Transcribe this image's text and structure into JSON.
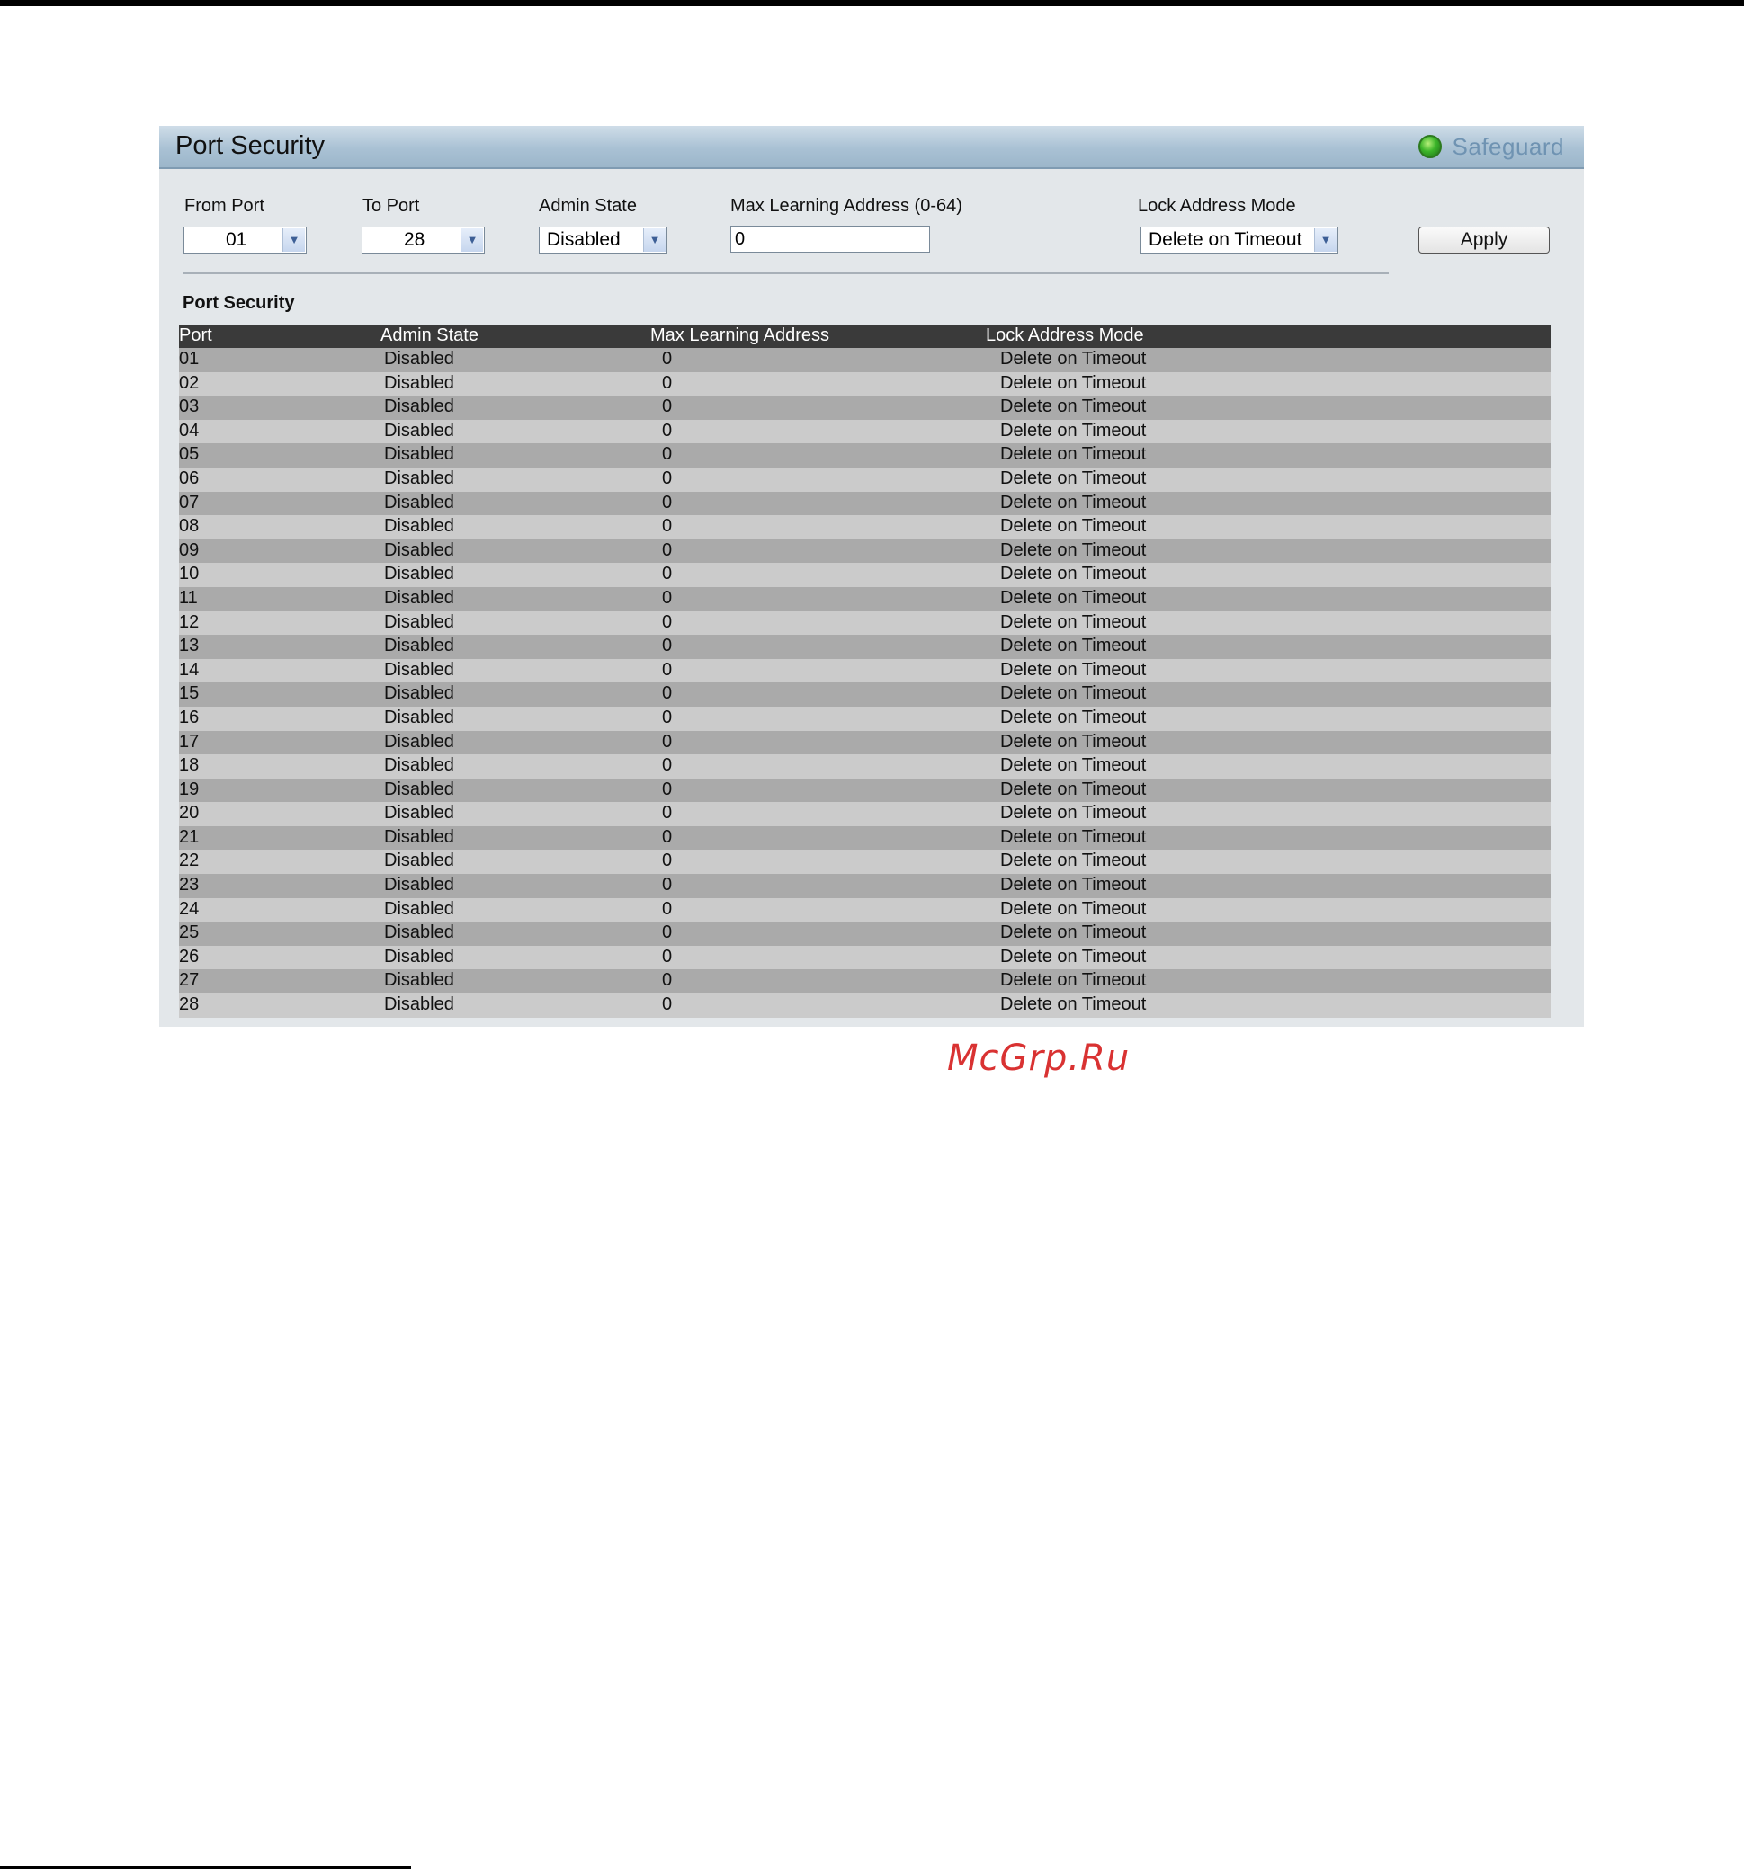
{
  "panel": {
    "title": "Port Security",
    "safeguard_label": "Safeguard"
  },
  "form": {
    "from_port_label": "From Port",
    "from_port_value": "01",
    "to_port_label": "To Port",
    "to_port_value": "28",
    "admin_state_label": "Admin State",
    "admin_state_value": "Disabled",
    "max_learning_label": "Max Learning Address (0-64)",
    "max_learning_value": "0",
    "lock_mode_label": "Lock Address Mode",
    "lock_mode_value": "Delete on Timeout",
    "apply_label": "Apply"
  },
  "table": {
    "section_title": "Port Security",
    "headers": [
      "Port",
      "Admin State",
      "Max Learning Address",
      "Lock Address Mode"
    ],
    "rows": [
      {
        "port": "01",
        "admin_state": "Disabled",
        "max_learning": "0",
        "lock_mode": "Delete on Timeout"
      },
      {
        "port": "02",
        "admin_state": "Disabled",
        "max_learning": "0",
        "lock_mode": "Delete on Timeout"
      },
      {
        "port": "03",
        "admin_state": "Disabled",
        "max_learning": "0",
        "lock_mode": "Delete on Timeout"
      },
      {
        "port": "04",
        "admin_state": "Disabled",
        "max_learning": "0",
        "lock_mode": "Delete on Timeout"
      },
      {
        "port": "05",
        "admin_state": "Disabled",
        "max_learning": "0",
        "lock_mode": "Delete on Timeout"
      },
      {
        "port": "06",
        "admin_state": "Disabled",
        "max_learning": "0",
        "lock_mode": "Delete on Timeout"
      },
      {
        "port": "07",
        "admin_state": "Disabled",
        "max_learning": "0",
        "lock_mode": "Delete on Timeout"
      },
      {
        "port": "08",
        "admin_state": "Disabled",
        "max_learning": "0",
        "lock_mode": "Delete on Timeout"
      },
      {
        "port": "09",
        "admin_state": "Disabled",
        "max_learning": "0",
        "lock_mode": "Delete on Timeout"
      },
      {
        "port": "10",
        "admin_state": "Disabled",
        "max_learning": "0",
        "lock_mode": "Delete on Timeout"
      },
      {
        "port": "11",
        "admin_state": "Disabled",
        "max_learning": "0",
        "lock_mode": "Delete on Timeout"
      },
      {
        "port": "12",
        "admin_state": "Disabled",
        "max_learning": "0",
        "lock_mode": "Delete on Timeout"
      },
      {
        "port": "13",
        "admin_state": "Disabled",
        "max_learning": "0",
        "lock_mode": "Delete on Timeout"
      },
      {
        "port": "14",
        "admin_state": "Disabled",
        "max_learning": "0",
        "lock_mode": "Delete on Timeout"
      },
      {
        "port": "15",
        "admin_state": "Disabled",
        "max_learning": "0",
        "lock_mode": "Delete on Timeout"
      },
      {
        "port": "16",
        "admin_state": "Disabled",
        "max_learning": "0",
        "lock_mode": "Delete on Timeout"
      },
      {
        "port": "17",
        "admin_state": "Disabled",
        "max_learning": "0",
        "lock_mode": "Delete on Timeout"
      },
      {
        "port": "18",
        "admin_state": "Disabled",
        "max_learning": "0",
        "lock_mode": "Delete on Timeout"
      },
      {
        "port": "19",
        "admin_state": "Disabled",
        "max_learning": "0",
        "lock_mode": "Delete on Timeout"
      },
      {
        "port": "20",
        "admin_state": "Disabled",
        "max_learning": "0",
        "lock_mode": "Delete on Timeout"
      },
      {
        "port": "21",
        "admin_state": "Disabled",
        "max_learning": "0",
        "lock_mode": "Delete on Timeout"
      },
      {
        "port": "22",
        "admin_state": "Disabled",
        "max_learning": "0",
        "lock_mode": "Delete on Timeout"
      },
      {
        "port": "23",
        "admin_state": "Disabled",
        "max_learning": "0",
        "lock_mode": "Delete on Timeout"
      },
      {
        "port": "24",
        "admin_state": "Disabled",
        "max_learning": "0",
        "lock_mode": "Delete on Timeout"
      },
      {
        "port": "25",
        "admin_state": "Disabled",
        "max_learning": "0",
        "lock_mode": "Delete on Timeout"
      },
      {
        "port": "26",
        "admin_state": "Disabled",
        "max_learning": "0",
        "lock_mode": "Delete on Timeout"
      },
      {
        "port": "27",
        "admin_state": "Disabled",
        "max_learning": "0",
        "lock_mode": "Delete on Timeout"
      },
      {
        "port": "28",
        "admin_state": "Disabled",
        "max_learning": "0",
        "lock_mode": "Delete on Timeout"
      }
    ]
  },
  "watermark": "McGrp.Ru",
  "icons": {
    "safeguard": "status-light-icon",
    "dropdown": "chevron-down-icon"
  },
  "colors": {
    "header_bar": "#a9c1d4",
    "safeguard_text": "#6f93b2",
    "safeguard_light": "#3cb52a",
    "table_header": "#3a3a3a",
    "row_dark": "#aaaaaa",
    "row_light": "#cbcbcb",
    "watermark": "#d93232"
  }
}
